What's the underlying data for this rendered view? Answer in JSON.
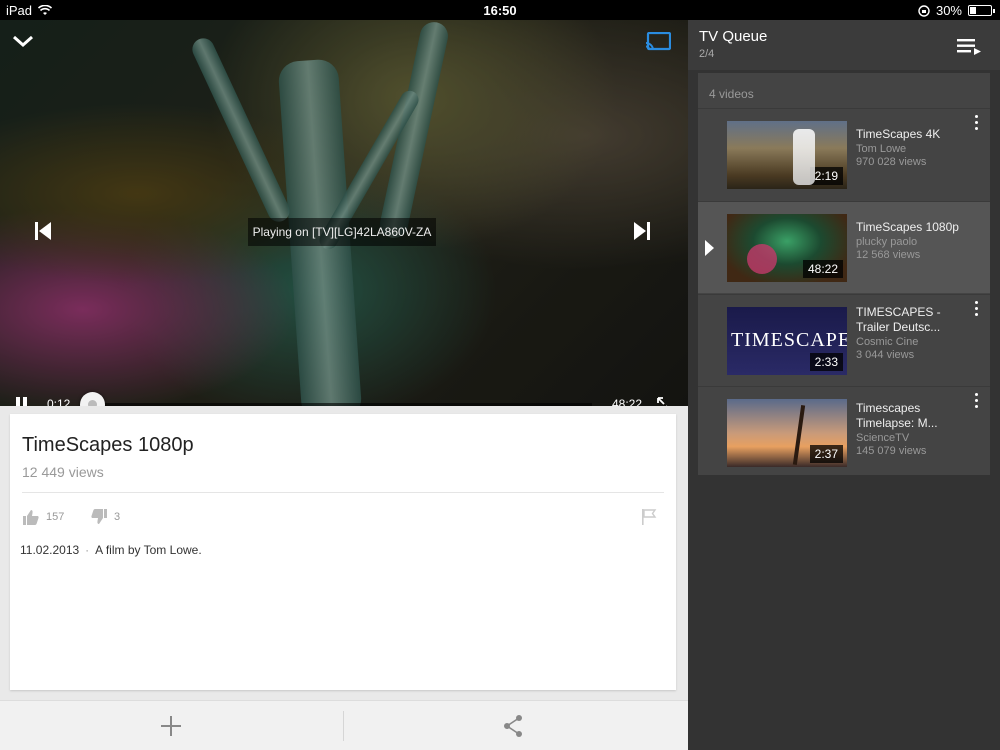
{
  "status_bar": {
    "device": "iPad",
    "time": "16:50",
    "battery": "30%",
    "battery_level": 0.3
  },
  "player": {
    "now_playing": "Playing on [TV][LG]42LA860V-ZA",
    "current_time": "0:12",
    "duration": "48:22",
    "progress_fraction": 0.004
  },
  "video": {
    "title": "TimeScapes 1080p",
    "views": "12 449 views",
    "likes": "157",
    "dislikes": "3",
    "date": "11.02.2013",
    "separator": "·",
    "description": "A film by Tom Lowe."
  },
  "queue": {
    "title": "TV Queue",
    "position": "2/4",
    "count": "4 videos",
    "items": [
      {
        "title": "TimeScapes 4K",
        "channel": "Tom Lowe",
        "views": "970 028 views",
        "duration": "2:19",
        "active": false
      },
      {
        "title": "TimeScapes 1080p",
        "channel": "plucky paolo",
        "views": "12 568 views",
        "duration": "48:22",
        "active": true
      },
      {
        "title": "TIMESCAPES - Trailer Deutsc...",
        "channel": "Cosmic Cine",
        "views": "3 044 views",
        "duration": "2:33",
        "active": false,
        "thumb_text": "TIMESCAPES"
      },
      {
        "title": "Timescapes Timelapse: M...",
        "channel": "ScienceTV",
        "views": "145 079 views",
        "duration": "2:37",
        "active": false
      }
    ]
  },
  "icons": {
    "collapse": "chevron-down-icon",
    "cast": "cast-icon",
    "prev": "skip-previous-icon",
    "next": "skip-next-icon",
    "pause": "pause-icon",
    "expand": "fullscreen-icon",
    "like": "thumbs-up-icon",
    "dislike": "thumbs-down-icon",
    "flag": "flag-icon",
    "add": "add-icon",
    "share": "share-icon",
    "queue_menu": "playlist-icon",
    "more": "more-vert-icon"
  },
  "colors": {
    "queue_bg": "#333333",
    "queue_list_bg": "#444444",
    "active_item_bg": "#555555",
    "cast_accent": "#2a8ce0"
  }
}
